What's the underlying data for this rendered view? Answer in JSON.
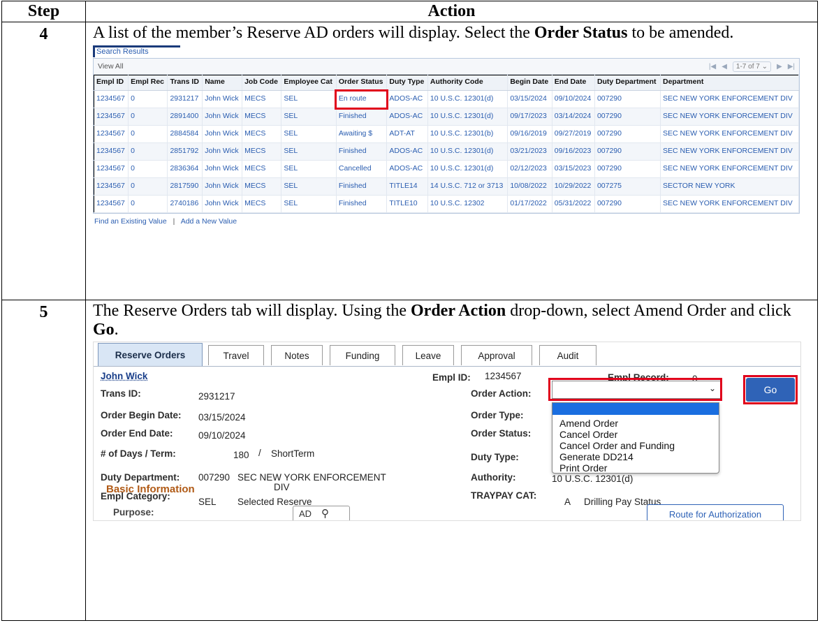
{
  "table_header": {
    "step": "Step",
    "action": "Action"
  },
  "step4": {
    "number": "4",
    "text_before": "A list of the member’s Reserve AD orders will display. Select the ",
    "bold": "Order Status",
    "text_after": " to be amended.",
    "search_results": {
      "title": "Search Results",
      "view_all": "View All",
      "pager": {
        "first": "|◀",
        "prev": "◀",
        "range": "1-7 of 7",
        "next": "▶",
        "last": "▶|"
      },
      "columns": [
        "Empl ID",
        "Empl Rec",
        "Trans ID",
        "Name",
        "Job Code",
        "Employee Cat",
        "Order Status",
        "Duty Type",
        "Authority Code",
        "Begin Date",
        "End Date",
        "Duty Department",
        "Department"
      ],
      "rows": [
        [
          "1234567",
          "0",
          "2931217",
          "John Wick",
          "MECS",
          "SEL",
          "En route",
          "ADOS-AC",
          "10 U.S.C. 12301(d)",
          "03/15/2024",
          "09/10/2024",
          "007290",
          "SEC NEW YORK ENFORCEMENT DIV"
        ],
        [
          "1234567",
          "0",
          "2891400",
          "John Wick",
          "MECS",
          "SEL",
          "Finished",
          "ADOS-AC",
          "10 U.S.C. 12301(d)",
          "09/17/2023",
          "03/14/2024",
          "007290",
          "SEC NEW YORK ENFORCEMENT DIV"
        ],
        [
          "1234567",
          "0",
          "2884584",
          "John Wick",
          "MECS",
          "SEL",
          "Awaiting $",
          "ADT-AT",
          "10 U.S.C. 12301(b)",
          "09/16/2019",
          "09/27/2019",
          "007290",
          "SEC NEW YORK ENFORCEMENT DIV"
        ],
        [
          "1234567",
          "0",
          "2851792",
          "John Wick",
          "MECS",
          "SEL",
          "Finished",
          "ADOS-AC",
          "10 U.S.C. 12301(d)",
          "03/21/2023",
          "09/16/2023",
          "007290",
          "SEC NEW YORK ENFORCEMENT DIV"
        ],
        [
          "1234567",
          "0",
          "2836364",
          "John Wick",
          "MECS",
          "SEL",
          "Cancelled",
          "ADOS-AC",
          "10 U.S.C. 12301(d)",
          "02/12/2023",
          "03/15/2023",
          "007290",
          "SEC NEW YORK ENFORCEMENT DIV"
        ],
        [
          "1234567",
          "0",
          "2817590",
          "John Wick",
          "MECS",
          "SEL",
          "Finished",
          "TITLE14",
          "14 U.S.C. 712 or 3713",
          "10/08/2022",
          "10/29/2022",
          "007275",
          "SECTOR NEW YORK"
        ],
        [
          "1234567",
          "0",
          "2740186",
          "John Wick",
          "MECS",
          "SEL",
          "Finished",
          "TITLE10",
          "10 U.S.C. 12302",
          "01/17/2022",
          "05/31/2022",
          "007290",
          "SEC NEW YORK ENFORCEMENT DIV"
        ]
      ],
      "footer_links": {
        "find": "Find an Existing Value",
        "sep": "|",
        "add": "Add a New Value"
      }
    }
  },
  "step5": {
    "number": "5",
    "text1": "The Reserve Orders tab will display. Using the ",
    "bold1": "Order Action",
    "text2": " drop-down, select Amend Order and click ",
    "bold2": "Go",
    "text3": ".",
    "reserve_orders": {
      "tabs": [
        "Reserve Orders",
        "Travel",
        "Notes",
        "Funding",
        "Leave",
        "Approval",
        "Audit"
      ],
      "name": "John Wick",
      "empl_id_label": "Empl ID:",
      "empl_id": "1234567",
      "empl_record_label": "Empl Record:",
      "empl_record": "0",
      "trans_id_label": "Trans ID:",
      "trans_id": "2931217",
      "order_begin_label": "Order Begin Date:",
      "order_begin": "03/15/2024",
      "order_end_label": "Order End Date:",
      "order_end": "09/10/2024",
      "days_term_label": "# of Days / Term:",
      "days": "180",
      "slash": "/",
      "term": "ShortTerm",
      "duty_dept_label": "Duty Department:",
      "duty_dept_code": "007290",
      "duty_dept_name_1": "SEC NEW YORK ENFORCEMENT",
      "duty_dept_name_2": "DIV",
      "empl_cat_label": "Empl Category:",
      "empl_cat_code": "SEL",
      "empl_cat_name": "Selected Reserve",
      "order_action_label": "Order Action:",
      "order_type_label": "Order Type:",
      "order_status_label": "Order Status:",
      "duty_type_label": "Duty Type:",
      "authority_label": "Authority:",
      "authority_partial": "10 U.S.C. 12301(d)",
      "traypay_label": "TRAYPAY CAT:",
      "traypay_code": "A",
      "traypay_name": "Drilling Pay Status",
      "go_label": "Go",
      "dropdown_options": [
        "Amend Order",
        "Cancel Order",
        "Cancel Order and Funding",
        "Generate DD214",
        "Print Order"
      ],
      "basic_info": "Basic Information",
      "purpose_label": "Purpose:",
      "purpose_value": "AD",
      "route_button": "Route for Authorization"
    }
  }
}
